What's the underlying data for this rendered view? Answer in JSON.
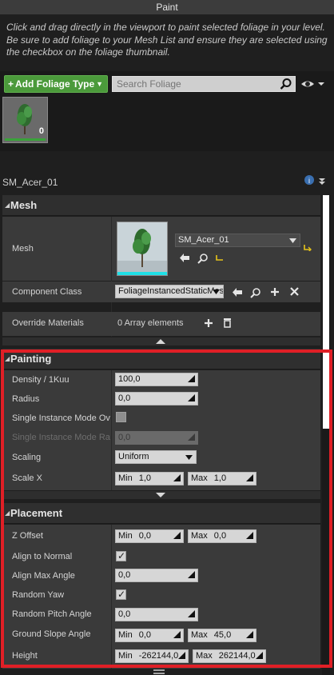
{
  "header": {
    "title": "Paint"
  },
  "info_text": "Click and drag directly in the viewport to paint selected foliage in your level. Be sure to add foliage to your Mesh List and ensure they are selected using the checkbox on the foliage thumbnail.",
  "toolbar": {
    "add_label": "Add Foliage Type",
    "search_placeholder": "Search Foliage"
  },
  "foliage_tile": {
    "count": "0"
  },
  "asset_name": "SM_Acer_01",
  "mesh_section": {
    "title": "Mesh",
    "mesh_label": "Mesh",
    "mesh_value": "SM_Acer_01",
    "component_label": "Component Class",
    "component_value": "FoliageInstancedStaticMeshComponent",
    "override_label": "Override Materials",
    "override_value": "0 Array elements"
  },
  "painting_section": {
    "title": "Painting",
    "rows": [
      {
        "label": "Density / 1Kuu",
        "value": "100,0"
      },
      {
        "label": "Radius",
        "value": "0,0"
      },
      {
        "label": "Single Instance Mode Override"
      },
      {
        "label": "Single Instance Mode Radius",
        "value": "0,0"
      },
      {
        "label": "Scaling",
        "value": "Uniform"
      },
      {
        "label": "Scale X",
        "min_label": "Min",
        "min_value": "1,0",
        "max_label": "Max",
        "max_value": "1,0"
      }
    ]
  },
  "placement_section": {
    "title": "Placement",
    "rows": [
      {
        "label": "Z Offset",
        "min_label": "Min",
        "min_value": "0,0",
        "max_label": "Max",
        "max_value": "0,0"
      },
      {
        "label": "Align to Normal"
      },
      {
        "label": "Align Max Angle",
        "value": "0,0"
      },
      {
        "label": "Random Yaw"
      },
      {
        "label": "Random Pitch Angle",
        "value": "0,0"
      },
      {
        "label": "Ground Slope Angle",
        "min_label": "Min",
        "min_value": "0,0",
        "max_label": "Max",
        "max_value": "45,0"
      },
      {
        "label": "Height",
        "min_label": "Min",
        "min_value": "-262144,0",
        "max_label": "Max",
        "max_value": "262144,0"
      }
    ]
  },
  "colors": {
    "highlight": "#e01f26",
    "add_button": "#4b9a3b"
  }
}
